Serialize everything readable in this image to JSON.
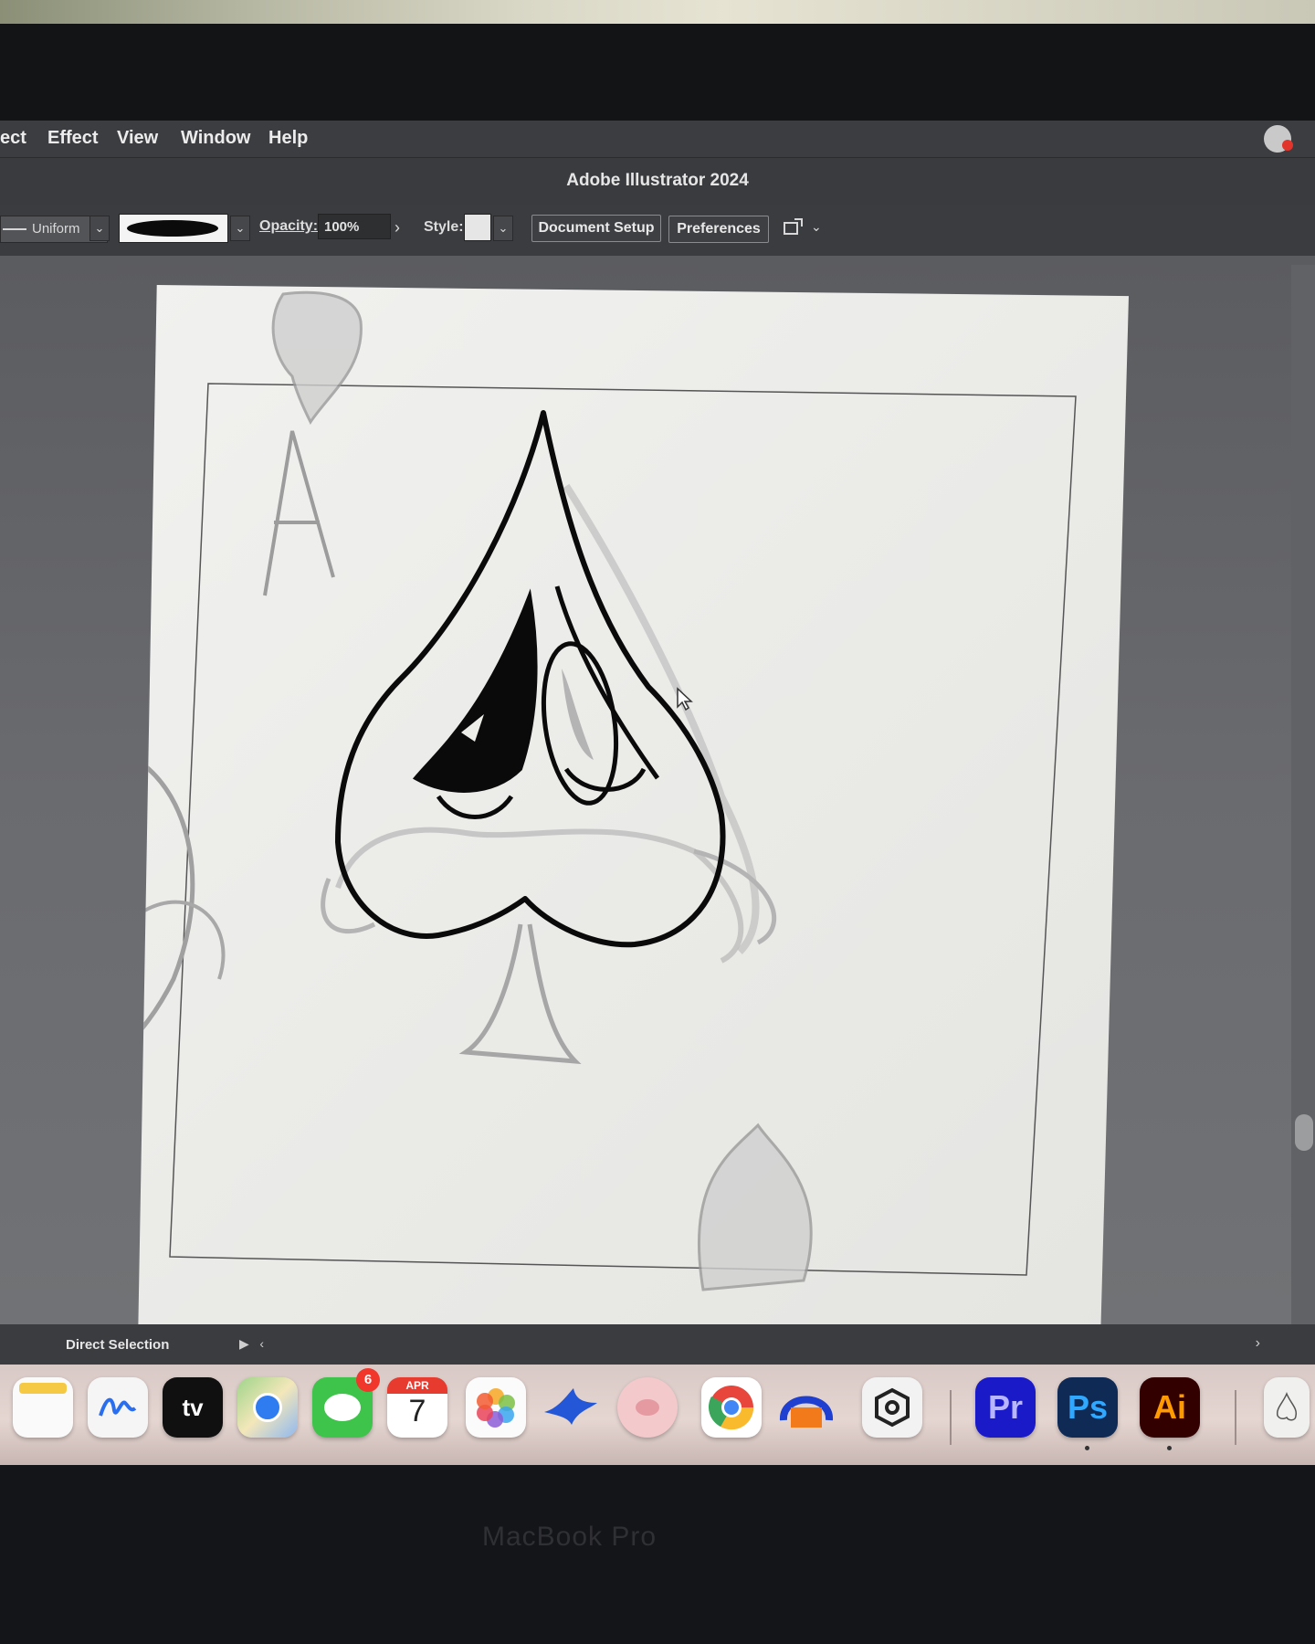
{
  "menubar": {
    "items": [
      "ect",
      "Effect",
      "View",
      "Window",
      "Help"
    ]
  },
  "window": {
    "title": "Adobe Illustrator 2024"
  },
  "control_bar": {
    "stroke_profile": "Uniform",
    "opacity_label": "Opacity:",
    "opacity_value": "100%",
    "style_label": "Style:",
    "document_setup": "Document Setup",
    "preferences": "Preferences"
  },
  "status_bar": {
    "tool": "Direct Selection"
  },
  "dock": {
    "apps": [
      {
        "name": "notes-icon",
        "label": ""
      },
      {
        "name": "freeform-icon",
        "label": ""
      },
      {
        "name": "apple-tv-icon",
        "label": "tv"
      },
      {
        "name": "maps-icon",
        "label": ""
      },
      {
        "name": "messages-icon",
        "label": "",
        "badge": "6"
      },
      {
        "name": "calendar-icon",
        "month": "APR",
        "day": "7"
      },
      {
        "name": "photos-icon",
        "label": ""
      },
      {
        "name": "bird-app-icon",
        "label": ""
      },
      {
        "name": "pig-app-icon",
        "label": ""
      },
      {
        "name": "chrome-icon",
        "label": ""
      },
      {
        "name": "audio-app-icon",
        "label": ""
      },
      {
        "name": "unity-icon",
        "label": ""
      },
      {
        "name": "premiere-icon",
        "label": "Pr"
      },
      {
        "name": "photoshop-icon",
        "label": "Ps"
      },
      {
        "name": "illustrator-icon",
        "label": "Ai"
      }
    ]
  },
  "bezel": {
    "label": "MacBook Pro"
  },
  "colors": {
    "ui_dark": "#3b3c3f",
    "canvas": "#eeeeec",
    "premiere": "#1a1ac8",
    "photoshop": "#0f2a55",
    "illustrator": "#330000",
    "badge": "#f1362c"
  }
}
